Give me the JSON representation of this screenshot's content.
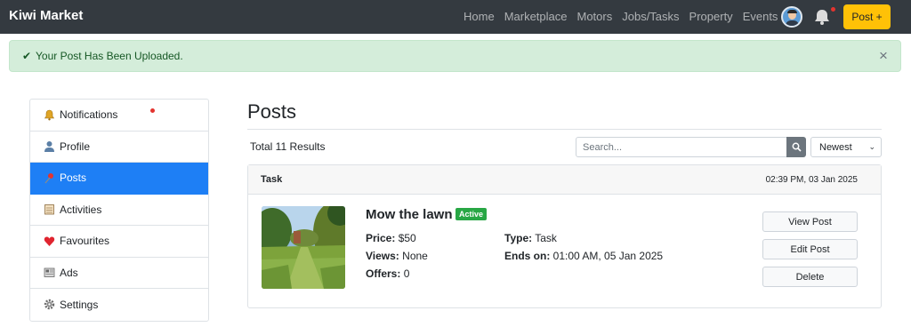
{
  "navbar": {
    "brand": "Kiwi Market",
    "links": [
      "Home",
      "Marketplace",
      "Motors",
      "Jobs/Tasks",
      "Property",
      "Events"
    ],
    "post_button": "Post +"
  },
  "alert": {
    "message": "Your Post Has Been Uploaded.",
    "close": "×"
  },
  "sidebar": {
    "items": [
      {
        "label": "Notifications",
        "icon": "bell-icon",
        "has_dot": true
      },
      {
        "label": "Profile",
        "icon": "person-icon"
      },
      {
        "label": "Posts",
        "icon": "pin-icon",
        "active": true
      },
      {
        "label": "Activities",
        "icon": "notepad-icon"
      },
      {
        "label": "Favourites",
        "icon": "heart-icon"
      },
      {
        "label": "Ads",
        "icon": "newspaper-icon"
      },
      {
        "label": "Settings",
        "icon": "gear-icon"
      }
    ]
  },
  "main": {
    "title": "Posts",
    "results_text": "Total 11 Results",
    "search_placeholder": "Search...",
    "sort_selected": "Newest"
  },
  "post": {
    "category": "Task",
    "date": "02:39 PM, 03 Jan 2025",
    "title": "Mow the lawn",
    "status": "Active",
    "price_label": "Price:",
    "price": "$50",
    "views_label": "Views:",
    "views": "None",
    "offers_label": "Offers:",
    "offers": "0",
    "type_label": "Type:",
    "type": "Task",
    "ends_label": "Ends on:",
    "ends": "01:00 AM, 05 Jan 2025",
    "actions": {
      "view": "View Post",
      "edit": "Edit Post",
      "delete": "Delete"
    }
  },
  "colors": {
    "navbar": "#343a40",
    "accent": "#1e7ff5",
    "post_button": "#ffc107",
    "alert_bg": "#d4edda",
    "badge": "#28a745"
  }
}
